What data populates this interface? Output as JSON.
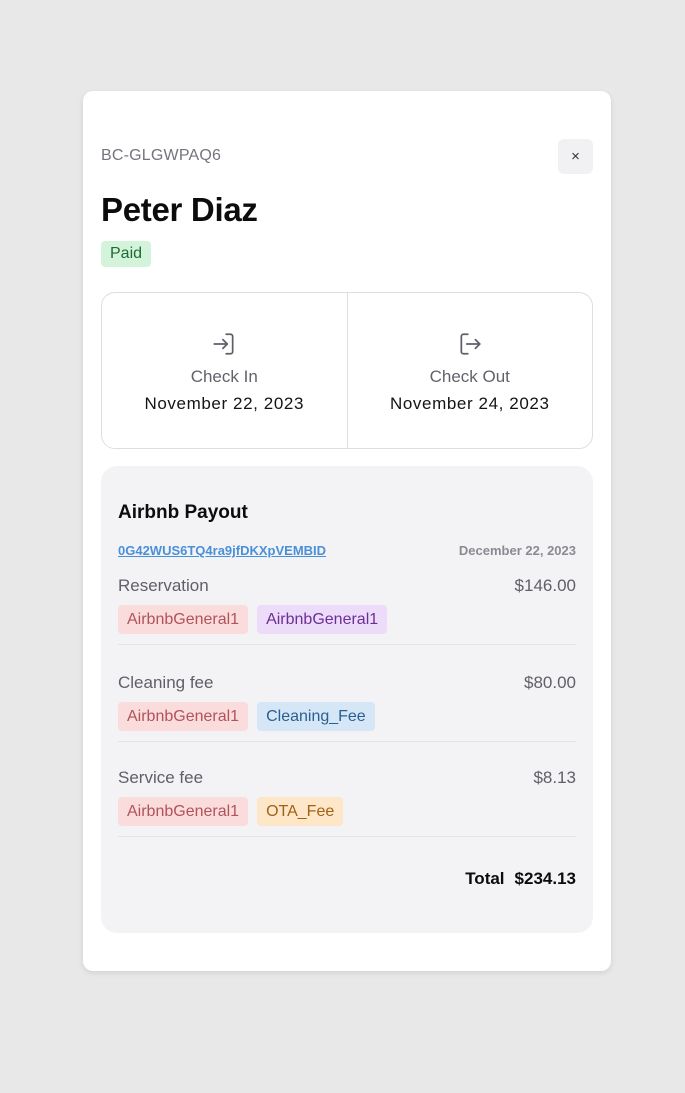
{
  "booking": {
    "code": "BC-GLGWPAQ6",
    "close_label": "×",
    "guest_name": "Peter Diaz",
    "status": "Paid"
  },
  "dates": {
    "check_in": {
      "label": "Check In",
      "value": "November 22, 2023",
      "icon": "login-icon"
    },
    "check_out": {
      "label": "Check Out",
      "value": "November 24, 2023",
      "icon": "logout-icon"
    }
  },
  "payout": {
    "title": "Airbnb Payout",
    "id": "0G42WUS6TQ4ra9jfDKXpVEMBID",
    "date": "December 22, 2023",
    "items": [
      {
        "label": "Reservation",
        "amount": "$146.00",
        "tags": [
          "AirbnbGeneral1",
          "AirbnbGeneral1"
        ]
      },
      {
        "label": "Cleaning fee",
        "amount": "$80.00",
        "tags": [
          "AirbnbGeneral1",
          "Cleaning_Fee"
        ]
      },
      {
        "label": "Service fee",
        "amount": "$8.13",
        "tags": [
          "AirbnbGeneral1",
          "OTA_Fee"
        ]
      }
    ],
    "total_label": "Total",
    "total_amount": "$234.13"
  },
  "colors": {
    "paid_badge_bg": "#d3f4da",
    "link": "#4a90d9",
    "tag_red_bg": "#fbdcdc",
    "tag_purple_bg": "#ecdcfa",
    "tag_blue_bg": "#d5e6f7",
    "tag_orange_bg": "#fde7c8"
  }
}
